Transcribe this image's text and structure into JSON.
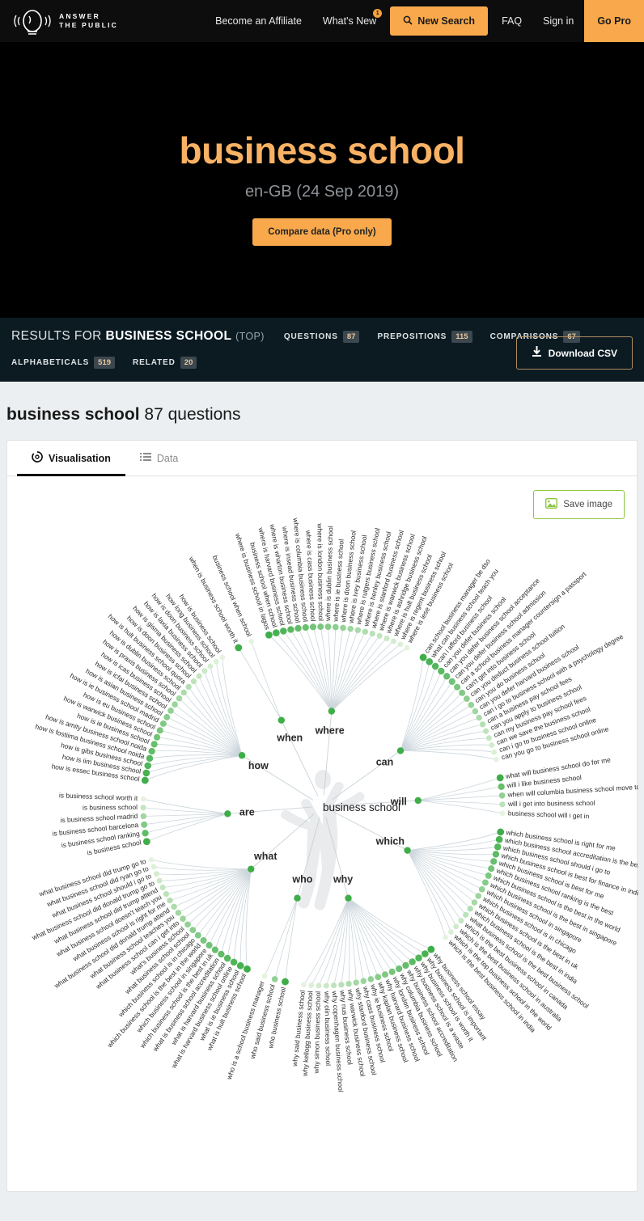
{
  "nav": {
    "logo_line1": "ANSWER",
    "logo_line2": "THE PUBLIC",
    "logo_icon": "lightbulb-head-icon",
    "affiliate": "Become an Affiliate",
    "whats_new": "What's New",
    "whats_new_badge": "1",
    "new_search": "New Search",
    "search_icon": "search-icon",
    "faq": "FAQ",
    "sign_in": "Sign in",
    "go_pro": "Go Pro"
  },
  "hero": {
    "keyword": "business school",
    "locale": "en-GB (24 Sep 2019)",
    "compare_label": "Compare data (Pro only)"
  },
  "results_bar": {
    "prefix": "RESULTS FOR",
    "keyword": "BUSINESS SCHOOL",
    "scope": "(TOP)",
    "chips": [
      {
        "label": "QUESTIONS",
        "count": "87"
      },
      {
        "label": "PREPOSITIONS",
        "count": "115"
      },
      {
        "label": "COMPARISONS",
        "count": "67"
      },
      {
        "label": "ALPHABETICALS",
        "count": "519"
      },
      {
        "label": "RELATED",
        "count": "20"
      }
    ],
    "download_label": "Download CSV",
    "download_icon": "download-icon"
  },
  "section": {
    "heading_keyword": "business school",
    "heading_count": "87 questions",
    "tabs": [
      {
        "label": "Visualisation",
        "icon": "donut-chart-icon",
        "active": true
      },
      {
        "label": "Data",
        "icon": "list-icon",
        "active": false
      }
    ],
    "save_image_label": "Save image",
    "save_image_icon": "image-icon"
  },
  "colors": {
    "accent_orange": "#f9a94b",
    "hero_keyword": "#f9b263",
    "results_bar_bg": "#0c1b22",
    "nav_bg": "#0d0d0d",
    "node_green_dark": "#3fae49",
    "node_green_light": "#e4f3de",
    "save_image_border": "#8cc63f"
  },
  "chart_data": {
    "type": "radial-tree",
    "title": "business school",
    "center_label": "business school",
    "total_questions": 87,
    "groups": [
      {
        "name": "when",
        "angle_deg": -90,
        "questions": [
          "when is business school worth it",
          "business school when school"
        ]
      },
      {
        "name": "where",
        "angle_deg": -45,
        "questions": [
          "where is business school in lagos",
          "business school when school",
          "where is harvard business school",
          "where is wharton business school",
          "where is insead business school",
          "where is columbia business school",
          "where is cass business school",
          "where is london business school",
          "where is dublin business school",
          "where is ie business school",
          "where is doon business school",
          "where is ivey business school",
          "where is rutgers business school",
          "where is henley business school",
          "where is stanford business school",
          "where is warwick business school",
          "where is ashridge business school",
          "where is hult business school",
          "where is regent business school",
          "where is iese business school"
        ]
      },
      {
        "name": "can",
        "angle_deg": 0,
        "questions": [
          "can school business manager be dso",
          "what can business school teach you",
          "can i afford business school",
          "can you defer business school",
          "can you defer business school acceptance",
          "can you defer business school admission",
          "can a school business manager countersign a passport",
          "can't get into business school",
          "can you deduct business school tuition",
          "can you do business school",
          "can you defer harvard business school",
          "can i go to business school with a psychology degree",
          "can a business pay school fees",
          "can you apply to business school",
          "can my business pay school fees",
          "can we save the business school",
          "can i go to business school online",
          "can you go to business school online"
        ]
      },
      {
        "name": "will",
        "angle_deg": 25,
        "questions": [
          "what will business school do for me",
          "will i like business school",
          "when will columbia business school move to manhattan",
          "will i get into business school",
          "business school will i get in"
        ]
      },
      {
        "name": "which",
        "angle_deg": 50,
        "questions": [
          "which business school is right for me",
          "which business school accreditation is the best",
          "which business school should i go to",
          "which business school is best for finance in india",
          "which business school is best for me",
          "which business school ranking is the best",
          "which business school is the best in the world",
          "which business school is the best in singapore",
          "which business school in singapore",
          "which business school is in chicago",
          "which business school is the best in uk",
          "which business school is the best in india",
          "what business school is the best business school",
          "which is the best business school in canada",
          "which is the best business school in australia",
          "which is the top business school in the world",
          "which is the best business school in india"
        ]
      },
      {
        "name": "why",
        "angle_deg": 90,
        "questions": [
          "why business school essay",
          "why business school is important",
          "why business school is worth it",
          "why business school is a waste",
          "why business school accreditation",
          "why columbia business school",
          "why london business school",
          "why harvard business school",
          "why kaplan business school",
          "why ie business school",
          "why cass business school",
          "why stanford business school",
          "why warwick business school",
          "why nus business school",
          "why copenhagen business school",
          "why olin business school",
          "why simon business school",
          "why kellogg business school",
          "why said business school"
        ]
      },
      {
        "name": "who",
        "angle_deg": 130,
        "questions": [
          "who business school",
          "who said business school",
          "who is a school business manager"
        ]
      },
      {
        "name": "what",
        "angle_deg": 180,
        "questions": [
          "what is hult business school",
          "what is ie business school",
          "what is harvard business school online",
          "what is harvard business school",
          "what is business school accreditation",
          "which business school is the best in uk",
          "which business school in singapore",
          "which business school is the best in the world",
          "which business school is in chicago",
          "what business school school",
          "what's business school",
          "what business school can i get into",
          "what business school teaches you",
          "what business school did donald trump attend",
          "what business school is right for me",
          "what business school doesn't teach you",
          "what business school did trump attend",
          "what business school did donald trump go to",
          "what business school should i go to",
          "what business school did ryan go to",
          "what business school did trump go to"
        ]
      },
      {
        "name": "are",
        "angle_deg": 205,
        "questions": [
          "is business school",
          "is business school ranking",
          "is business school barcelona",
          "is business school madrid",
          "is business school",
          "is business school worth it"
        ]
      },
      {
        "name": "how",
        "angle_deg": 240,
        "questions": [
          "how is essec business school",
          "how is iim business school",
          "how is gibs business school",
          "how is fostiima business school noida",
          "how is amity business school noida",
          "how is ie business school",
          "how is warwick business school",
          "how is eu business school",
          "how is ie business school madrid",
          "how is asian business school",
          "how is icfai business school",
          "how is icas business school",
          "how is praxis business school",
          "how is dublin business school",
          "how is hult business school quora",
          "how is doon business school",
          "how is gisma business school",
          "how is laxia business school",
          "how is doon business school",
          "how long business school",
          "how is business school"
        ]
      }
    ]
  }
}
